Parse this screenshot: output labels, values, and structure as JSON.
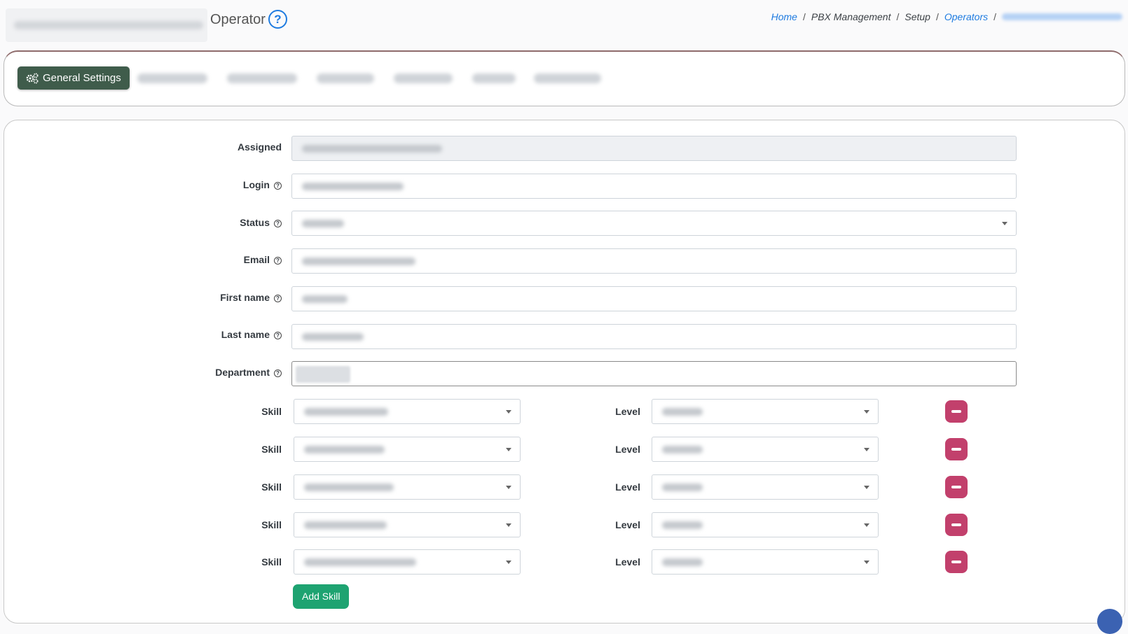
{
  "header": {
    "title": "Operator",
    "breadcrumb": [
      {
        "label": "Home",
        "link": true
      },
      {
        "label": "PBX Management",
        "link": false
      },
      {
        "label": "Setup",
        "link": false
      },
      {
        "label": "Operators",
        "link": true
      }
    ]
  },
  "tabs": {
    "active_label": "General Settings"
  },
  "form": {
    "assigned_label": "Assigned",
    "login_label": "Login",
    "status_label": "Status",
    "email_label": "Email",
    "first_name_label": "First name",
    "last_name_label": "Last name",
    "department_label": "Department",
    "skill_label": "Skill",
    "level_label": "Level",
    "add_skill_label": "Add Skill"
  },
  "colors": {
    "link": "#1e7be0",
    "tab_active": "#3f5c4b",
    "remove": "#c2406c",
    "add": "#1ea371"
  }
}
